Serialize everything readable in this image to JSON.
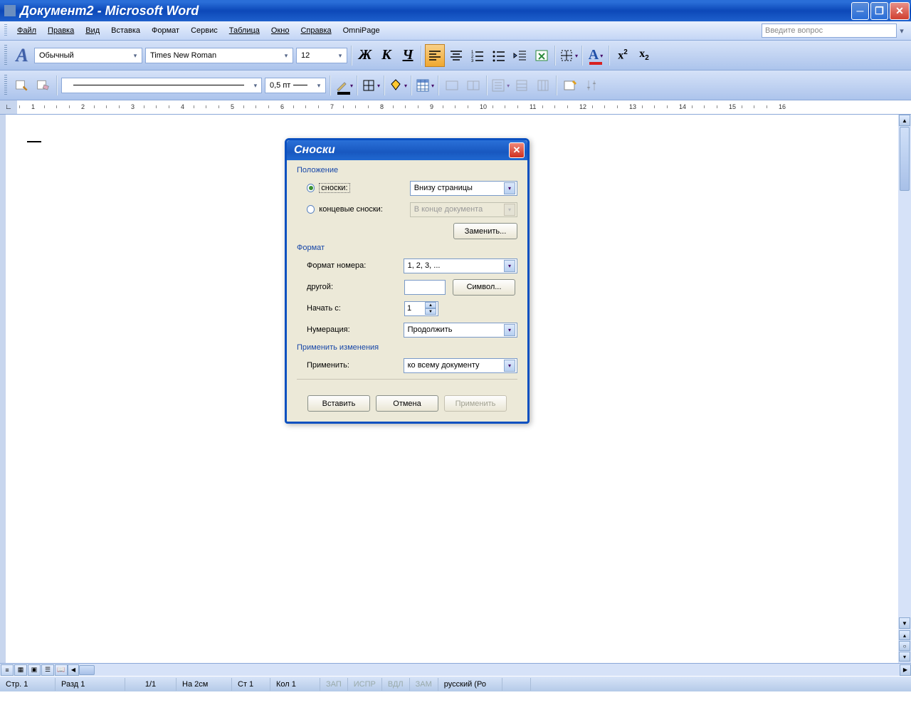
{
  "titlebar": {
    "text": "Документ2 - Microsoft Word"
  },
  "menu": {
    "file": "Файл",
    "edit": "Правка",
    "view": "Вид",
    "insert": "Вставка",
    "format": "Формат",
    "service": "Сервис",
    "table": "Таблица",
    "window": "Окно",
    "help": "Справка",
    "omnipage": "OmniPage"
  },
  "help_placeholder": "Введите вопрос",
  "toolbar1": {
    "style": "Обычный",
    "font": "Times New Roman",
    "size": "12",
    "bold": "Ж",
    "italic": "К",
    "underline": "Ч",
    "super": "x²",
    "sub": "x₂"
  },
  "toolbar2": {
    "line_weight": "0,5 пт"
  },
  "dialog": {
    "title": "Сноски",
    "section_position": "Положение",
    "radio_footnotes": "сноски:",
    "radio_endnotes": "концевые сноски:",
    "footnote_pos": "Внизу страницы",
    "endnote_pos": "В конце документа",
    "btn_replace": "Заменить...",
    "section_format": "Формат",
    "lbl_number_format": "Формат номера:",
    "number_format": "1, 2, 3, ...",
    "lbl_other": "другой:",
    "btn_symbol": "Символ...",
    "lbl_start_at": "Начать с:",
    "start_at": "1",
    "lbl_numbering": "Нумерация:",
    "numbering": "Продолжить",
    "section_apply": "Применить изменения",
    "lbl_apply_to": "Применить:",
    "apply_to": "ко всему документу",
    "btn_insert": "Вставить",
    "btn_cancel": "Отмена",
    "btn_apply": "Применить"
  },
  "status": {
    "page": "Стр. 1",
    "section": "Разд 1",
    "pages": "1/1",
    "at": "На 2см",
    "line": "Ст 1",
    "col": "Кол 1",
    "rec": "ЗАП",
    "trk": "ИСПР",
    "ext": "ВДЛ",
    "ovr": "ЗАМ",
    "lang": "русский (Ро"
  },
  "ruler_ticks": [
    "1",
    "2",
    "3",
    "4",
    "5",
    "6",
    "7",
    "8",
    "9",
    "10",
    "11",
    "12",
    "13",
    "14",
    "15",
    "16"
  ]
}
